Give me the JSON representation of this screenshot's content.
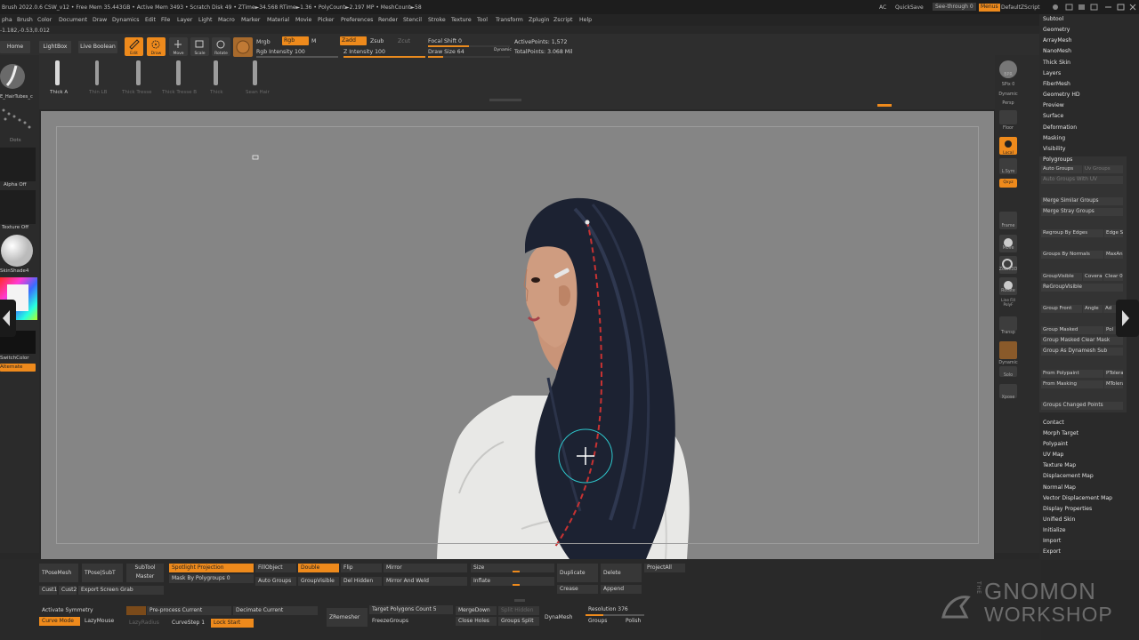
{
  "titlebar": {
    "status": "Brush 2022.0.6    CSW_v12    • Free Mem 35.443GB • Active Mem 3493 • Scratch Disk 49 • ZTime►34.568 RTime►1.36 • PolyCount►2.197 MP • MeshCount►58",
    "ac_label": "AC",
    "quicksave": "QuickSave",
    "see_through": "See-through  0",
    "menus_button": "Menus",
    "default_zscript": "DefaultZScript"
  },
  "menubar": [
    "pha",
    "Brush",
    "Color",
    "Document",
    "Draw",
    "Dynamics",
    "Edit",
    "File",
    "Layer",
    "Light",
    "Macro",
    "Marker",
    "Material",
    "Movie",
    "Picker",
    "Preferences",
    "Render",
    "Stencil",
    "Stroke",
    "Texture",
    "Tool",
    "Transform",
    "Zplugin",
    "Zscript",
    "Help"
  ],
  "coords": "-1.182,-0.53,0.012",
  "toolbar": {
    "home_page": "Home Page",
    "lightbox": "LightBox",
    "live_boolean": "Live Boolean",
    "edit": "Edit",
    "draw": "Draw",
    "move": "Move",
    "scale": "Scale",
    "rotate": "Rotate",
    "mrgb": "Mrgb",
    "rgb": "Rgb",
    "m": "M",
    "rgb_intensity": "Rgb Intensity 100",
    "zadd": "Zadd",
    "zsub": "Zsub",
    "zcut": "Zcut",
    "z_intensity": "Z Intensity 100",
    "focal_shift": "Focal Shift 0",
    "draw_size": "Draw Size 64",
    "dynamic": "Dynamic",
    "active_points": "ActivePoints: 1,572",
    "total_points": "TotalPoints: 3.068 Mil",
    "brushes": [
      "Thick A",
      "Thin LB",
      "Thick Tresse",
      "Thick Tresse B",
      "Thick",
      "Sean Hair"
    ]
  },
  "leftpanel": {
    "brush_name": "E_HairTubes_c",
    "stroke": "Dots",
    "alpha": "Alpha Off",
    "texture": "Texture Off",
    "material": "SkinShade4",
    "switch_color": "SwitchColor",
    "alternate": "Alternate"
  },
  "rightstrip": {
    "bpr": "BPR",
    "spix": "SPix 0",
    "dynamic": "Dynamic",
    "persp": "Persp",
    "floor": "Floor",
    "local": "Local",
    "lsym": "L.Sym",
    "qxyz": "Qxyz",
    "frame": "Frame",
    "move": "Move",
    "zoom3d": "Zoom3D",
    "rotate": "Rotate",
    "linefill": "Line Fill PolyF",
    "transp": "Transp",
    "dynamic2": "Dynamic",
    "solo": "Solo",
    "xpose": "Xpose"
  },
  "rpanel": {
    "top_items": [
      "Subtool",
      "Geometry",
      "ArrayMesh",
      "NanoMesh",
      "Thick Skin",
      "Layers",
      "FiberMesh",
      "Geometry HD",
      "Preview",
      "Surface",
      "Deformation",
      "Masking",
      "Visibility"
    ],
    "polygroups_title": "Polygroups",
    "polygroups": {
      "auto_groups": "Auto Groups",
      "uv_groups": "Uv Groups",
      "auto_groups_uv": "Auto Groups With UV",
      "merge_similar": "Merge Similar Groups",
      "merge_stray": "Merge Stray Groups",
      "regroup_edges": "Regroup By Edges",
      "edge_se": "Edge Se",
      "groups_normals": "Groups By Normals",
      "maxang": "MaxAn",
      "group_visible": "GroupVisible",
      "coverage": "Coverag",
      "clear": "Clear 0",
      "regroup_visible": "ReGroupVisible",
      "group_front": "Group Front",
      "angle": "Angle",
      "ad": "Ad",
      "group_masked": "Group Masked",
      "pol": "Pol",
      "group_masked_clear": "Group Masked Clear Mask",
      "group_dynamesh": "Group As Dynamesh Sub",
      "from_polypaint": "From Polypaint",
      "ptolerance": "PToleran",
      "from_masking": "From Masking",
      "mtolerance": "MToleran",
      "groups_changed": "Groups Changed Points"
    },
    "bottom_items": [
      "Contact",
      "Morph Target",
      "Polypaint",
      "UV Map",
      "Texture Map",
      "Displacement Map",
      "Normal Map",
      "Vector Displacement Map",
      "Display Properties",
      "Unified Skin",
      "Initialize",
      "Import",
      "Export"
    ]
  },
  "bottombar": {
    "tposemesh": "TPoseMesh",
    "tpose_subt": "TPose|SubT",
    "subtool_master": "SubTool Master",
    "cust1": "Cust1",
    "cust2": "Cust2",
    "export_screen": "Export Screen Grab",
    "spotlight": "Spotlight Projection",
    "mask_polygroups": "Mask By Polygroups 0",
    "fillobject": "FillObject",
    "auto_groups": "Auto Groups",
    "double": "Double",
    "group_visible": "GroupVisible",
    "flip": "Flip",
    "del_hidden": "Del Hidden",
    "mirror": "Mirror",
    "mirror_weld": "Mirror And Weld",
    "size": "Size",
    "inflate": "Inflate",
    "duplicate": "Duplicate",
    "crease": "Crease",
    "delete": "Delete",
    "append": "Append",
    "projectall": "ProjectAll",
    "activate_symmetry": "Activate Symmetry",
    "curve_mode": "Curve Mode",
    "lazymouse": "LazyMouse",
    "lazyradius": "LazyRadius",
    "curvestep": "CurveStep 1",
    "lock_start": "Lock Start",
    "preprocess": "Pre-process Current",
    "decimate": "Decimate Current",
    "zremesher": "ZRemesher",
    "target_polys": "Target Polygons Count 5",
    "freezegroups": "FreezeGroups",
    "mergedown": "MergeDown",
    "close_holes": "Close Holes",
    "split_hidden": "Split Hidden",
    "groups_split": "Groups Split",
    "dynamesh": "DynaMesh",
    "resolution": "Resolution 376",
    "groups": "Groups",
    "polish": "Polish"
  },
  "watermark": {
    "the": "THE",
    "gnomon": "GNOMON",
    "workshop": "WORKSHOP"
  },
  "colors": {
    "accent": "#ee8a1c",
    "viewport_bg": "#858585",
    "hair": "#1c2232",
    "shirt": "#e8e8e6",
    "skin": "#c99478"
  }
}
